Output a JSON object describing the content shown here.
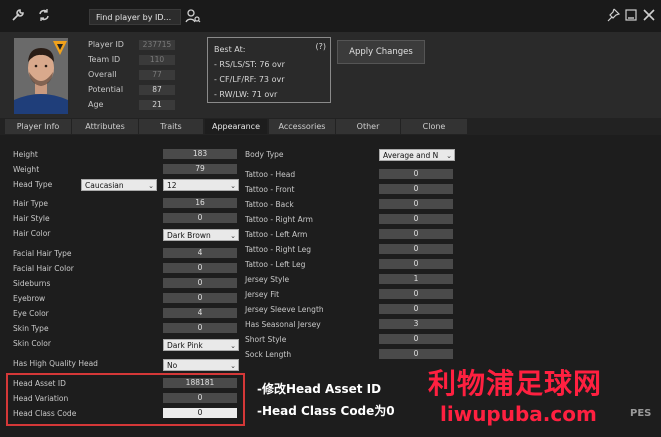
{
  "toolbar": {
    "find_label": "Find player by ID..."
  },
  "header": {
    "labels": [
      "Player ID",
      "Team ID",
      "Overall",
      "Potential",
      "Age"
    ],
    "values": [
      "237715",
      "110",
      "77",
      "87",
      "21"
    ],
    "best_at": {
      "title": "Best At:",
      "help": "(?)",
      "lines": [
        "- RS/LS/ST: 76 ovr",
        "- CF/LF/RF: 73 ovr",
        "- RW/LW: 71 ovr"
      ]
    },
    "apply_label": "Apply Changes"
  },
  "tabs": [
    "Player Info",
    "Attributes",
    "Traits",
    "Appearance",
    "Accessories",
    "Other",
    "Clone"
  ],
  "active_tab": "Appearance",
  "left_fields": {
    "height": {
      "label": "Height",
      "value": "183"
    },
    "weight": {
      "label": "Weight",
      "value": "79"
    },
    "head_type": {
      "label": "Head Type",
      "select": "Caucasian",
      "value": "12"
    },
    "hair_type": {
      "label": "Hair Type",
      "value": "16"
    },
    "hair_style": {
      "label": "Hair Style",
      "value": "0"
    },
    "hair_color": {
      "label": "Hair Color",
      "value": "Dark Brown"
    },
    "facial_hair_type": {
      "label": "Facial Hair Type",
      "value": "4"
    },
    "facial_hair_color": {
      "label": "Facial Hair Color",
      "value": "0"
    },
    "sideburns": {
      "label": "Sideburns",
      "value": "0"
    },
    "eyebrow": {
      "label": "Eyebrow",
      "value": "0"
    },
    "eye_color": {
      "label": "Eye Color",
      "value": "4"
    },
    "skin_type": {
      "label": "Skin Type",
      "value": "0"
    },
    "skin_color": {
      "label": "Skin Color",
      "value": "Dark Pink"
    },
    "hq_head": {
      "label": "Has High Quality Head",
      "value": "No"
    },
    "head_asset_id": {
      "label": "Head Asset ID",
      "value": "188181"
    },
    "head_variation": {
      "label": "Head Variation",
      "value": "0"
    },
    "head_class_code": {
      "label": "Head Class Code",
      "value": "0"
    }
  },
  "right_fields": {
    "body_type": {
      "label": "Body Type",
      "value": "Average and N"
    },
    "tattoo_head": {
      "label": "Tattoo - Head",
      "value": "0"
    },
    "tattoo_front": {
      "label": "Tattoo - Front",
      "value": "0"
    },
    "tattoo_back": {
      "label": "Tattoo - Back",
      "value": "0"
    },
    "tattoo_right_arm": {
      "label": "Tattoo - Right Arm",
      "value": "0"
    },
    "tattoo_left_arm": {
      "label": "Tattoo - Left Arm",
      "value": "0"
    },
    "tattoo_right_leg": {
      "label": "Tattoo - Right Leg",
      "value": "0"
    },
    "tattoo_left_leg": {
      "label": "Tattoo - Left Leg",
      "value": "0"
    },
    "jersey_style": {
      "label": "Jersey Style",
      "value": "1"
    },
    "jersey_fit": {
      "label": "Jersey Fit",
      "value": "0"
    },
    "jersey_sleeve": {
      "label": "Jersey Sleeve Length",
      "value": "0"
    },
    "seasonal_jersey": {
      "label": "Has Seasonal Jersey",
      "value": "3"
    },
    "short_style": {
      "label": "Short Style",
      "value": "0"
    },
    "sock_length": {
      "label": "Sock Length",
      "value": "0"
    }
  },
  "annotations": [
    "-修改Head Asset ID",
    "-Head Class Code为0"
  ],
  "watermark": {
    "cn": "利物浦足球网",
    "url": "liwupuba.com",
    "pes": "PES"
  }
}
